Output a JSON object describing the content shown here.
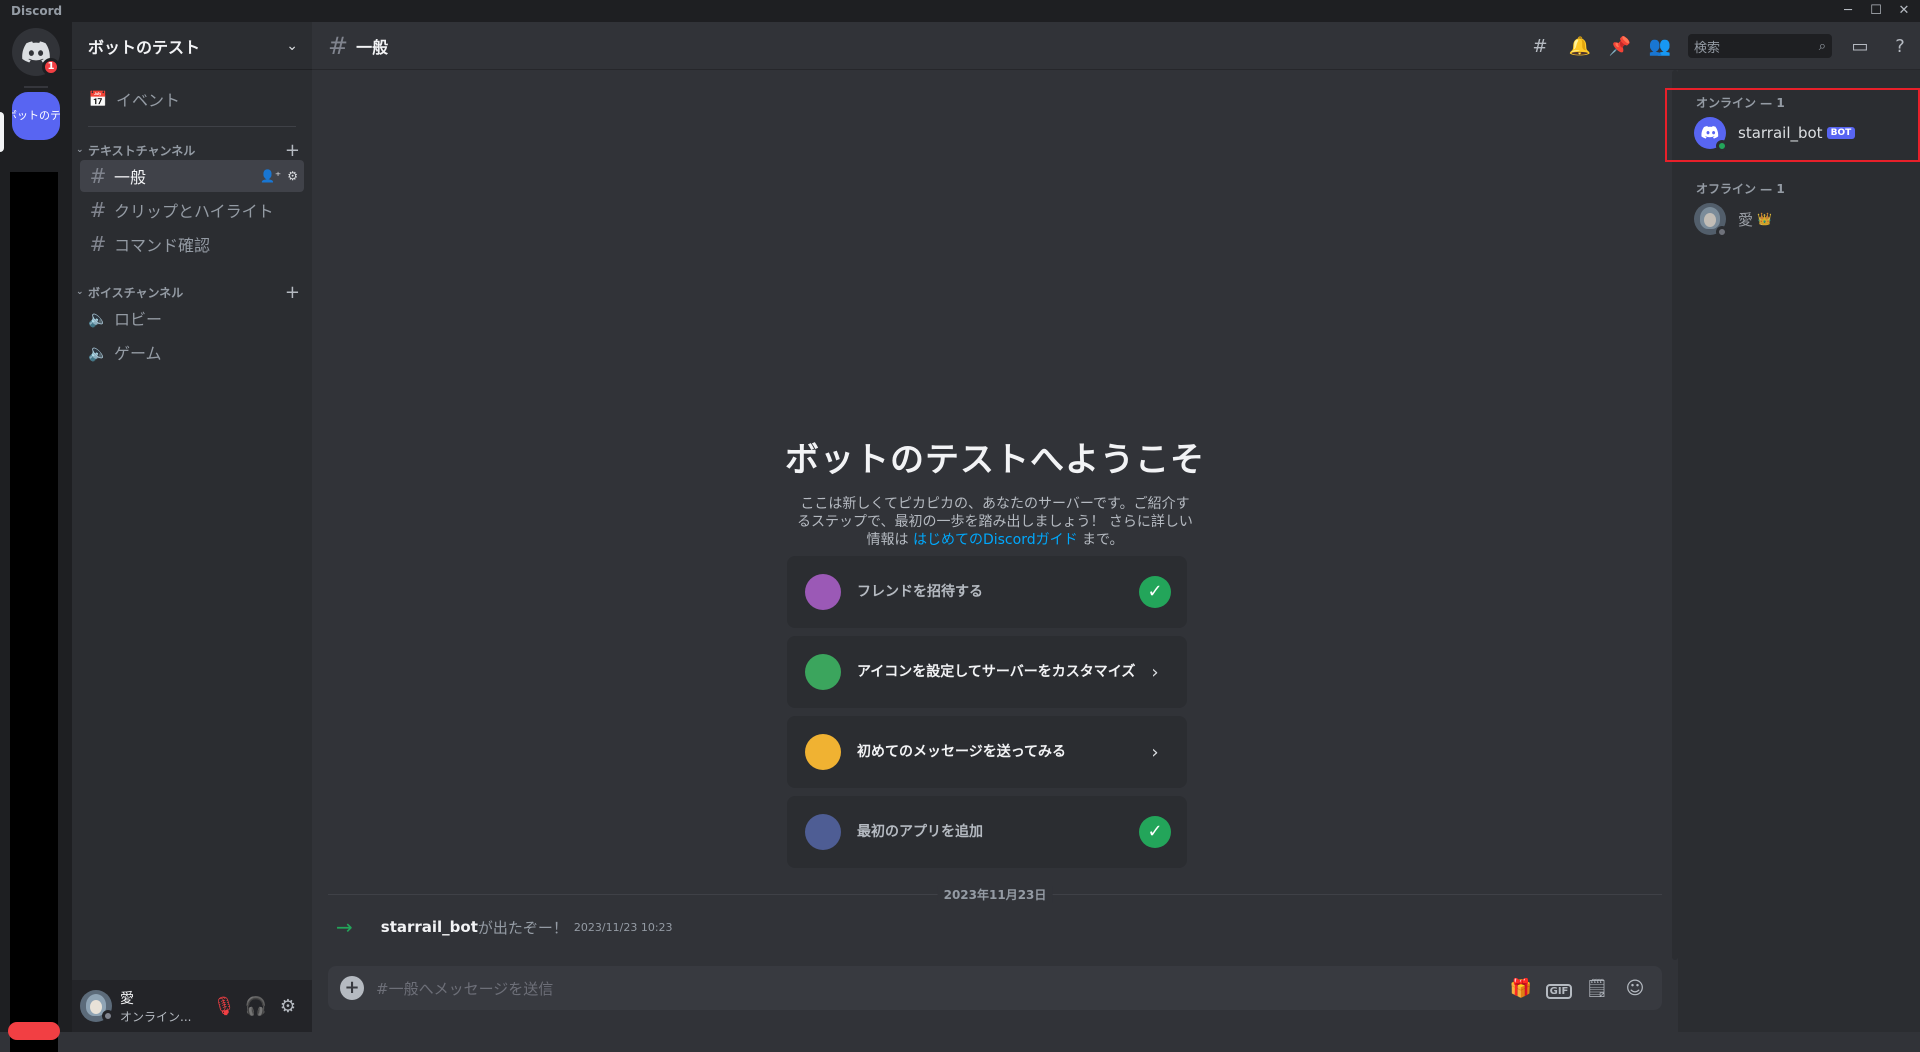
{
  "window": {
    "app_title": "Discord",
    "minimize": "─",
    "maximize": "☐",
    "close": "✕"
  },
  "rail": {
    "badge": "1",
    "server_abbrev": "ボットのテスト"
  },
  "guild": {
    "name": "ボットのテスト"
  },
  "sidebar": {
    "events_label": "イベント",
    "text_category": "テキストチャンネル",
    "voice_category": "ボイスチャンネル",
    "text_channels": [
      "一般",
      "クリップとハイライト",
      "コマンド確認"
    ],
    "voice_channels": [
      "ロビー",
      "ゲーム"
    ]
  },
  "user": {
    "name": "愛",
    "status": "オンライン..."
  },
  "channel": {
    "name": "一般"
  },
  "search": {
    "placeholder": "検索"
  },
  "welcome": {
    "title": "ボットのテストへようこそ",
    "desc_before": "ここは新しくてピカピカの、あなたのサーバーです。ご紹介するステップで、最初の一歩を踏み出しましょう！ さらに詳しい情報は ",
    "link": "はじめてのDiscordガイド",
    "desc_after": " まで。"
  },
  "cards": [
    {
      "label": "フレンドを招待する",
      "state": "done"
    },
    {
      "label": "アイコンを設定してサーバーをカスタマイズ",
      "state": "todo"
    },
    {
      "label": "初めてのメッセージを送ってみる",
      "state": "todo"
    },
    {
      "label": "最初のアプリを追加",
      "state": "done"
    }
  ],
  "messages": {
    "date_divider": "2023年11月23日",
    "system": {
      "user": "starrail_bot",
      "text": "が出たぞー！",
      "timestamp": "2023/11/23 10:23"
    }
  },
  "composer": {
    "placeholder": "#一般へメッセージを送信",
    "gif_label": "GIF"
  },
  "members": {
    "online_header": "オンライン — 1",
    "offline_header": "オフライン — 1",
    "online": [
      {
        "name": "starrail_bot",
        "badge": "BOT"
      }
    ],
    "offline": [
      {
        "name": "愛",
        "crown": "👑"
      }
    ]
  },
  "colors": {
    "blurple": "#5865f2",
    "online": "#23a55a",
    "highlight": "#e8202a"
  }
}
